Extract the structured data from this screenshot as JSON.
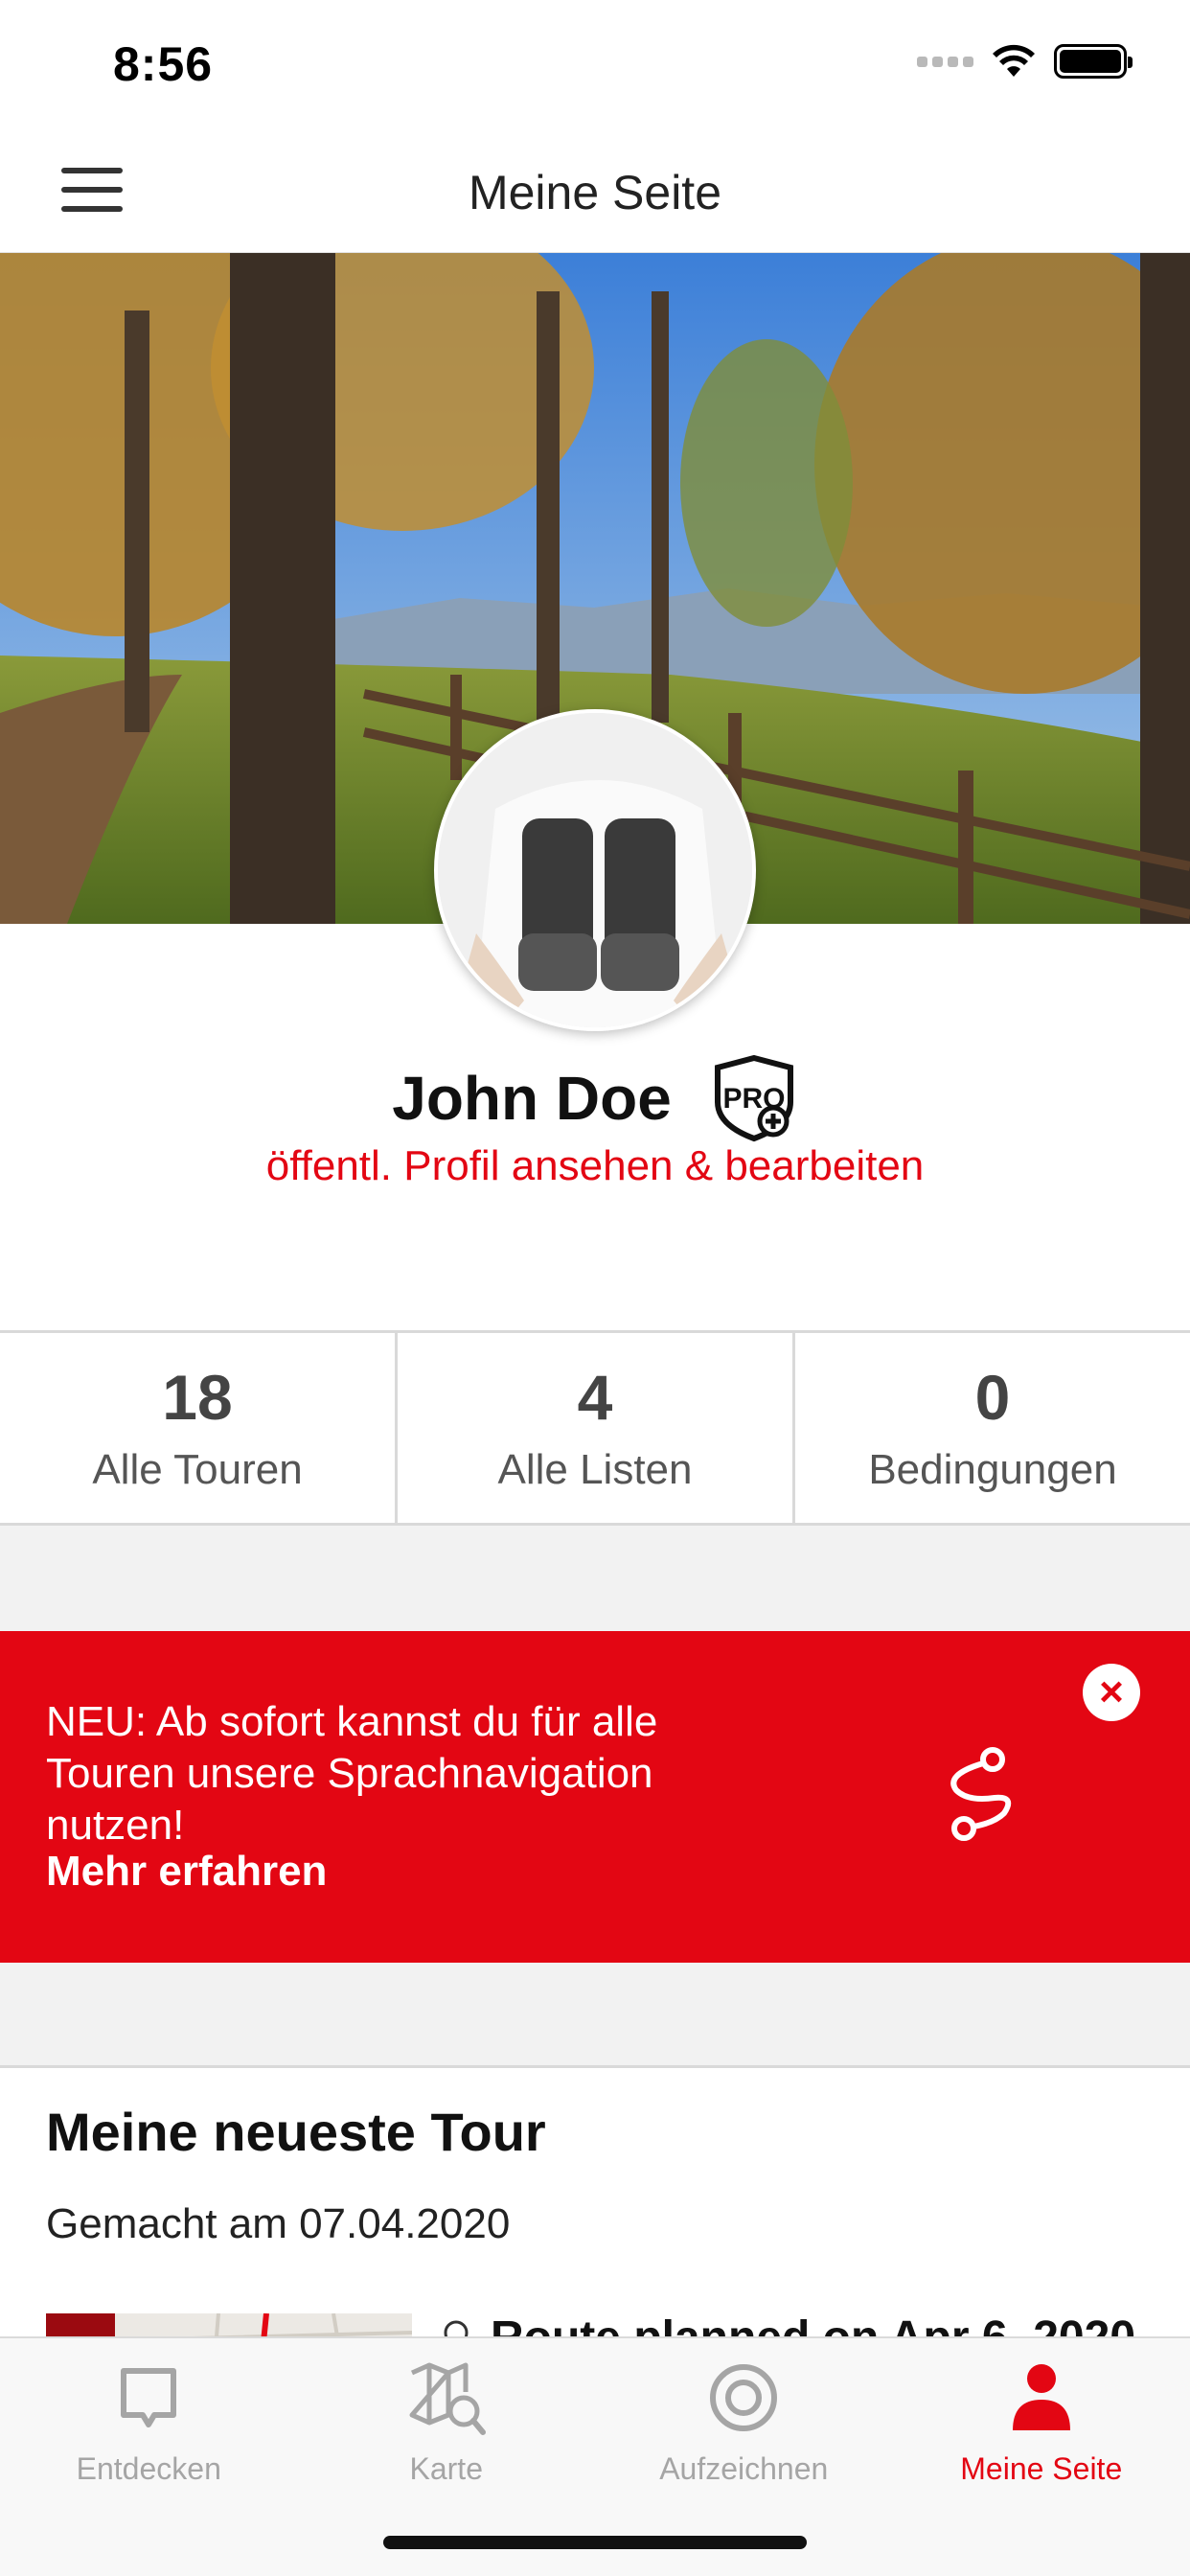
{
  "status_bar": {
    "time": "8:56"
  },
  "nav": {
    "title": "Meine Seite"
  },
  "profile": {
    "name": "John Doe",
    "badge": "PRO",
    "edit_link": "öffentl. Profil ansehen & bearbeiten"
  },
  "stats": [
    {
      "value": "18",
      "label": "Alle Touren"
    },
    {
      "value": "4",
      "label": "Alle Listen"
    },
    {
      "value": "0",
      "label": "Bedingungen"
    }
  ],
  "promo": {
    "text": "NEU: Ab sofort kannst du für alle Touren unsere Sprachnavigation nutzen!",
    "link": "Mehr erfahren",
    "close_symbol": "×",
    "icon": "route-icon"
  },
  "latest_tour": {
    "heading": "Meine neueste Tour",
    "date": "Gemacht am 07.04.2020",
    "title": "Route planned on Apr 6, 2020"
  },
  "tab_bar": {
    "tabs": [
      {
        "label": "Entdecken",
        "icon": "chat-bubble-icon",
        "active": false
      },
      {
        "label": "Karte",
        "icon": "map-search-icon",
        "active": false
      },
      {
        "label": "Aufzeichnen",
        "icon": "record-icon",
        "active": false
      },
      {
        "label": "Meine Seite",
        "icon": "person-icon",
        "active": true
      }
    ]
  },
  "colors": {
    "accent": "#e30613",
    "text": "#222222",
    "inactive": "#a5a5a5",
    "band": "#f2f2f2"
  }
}
